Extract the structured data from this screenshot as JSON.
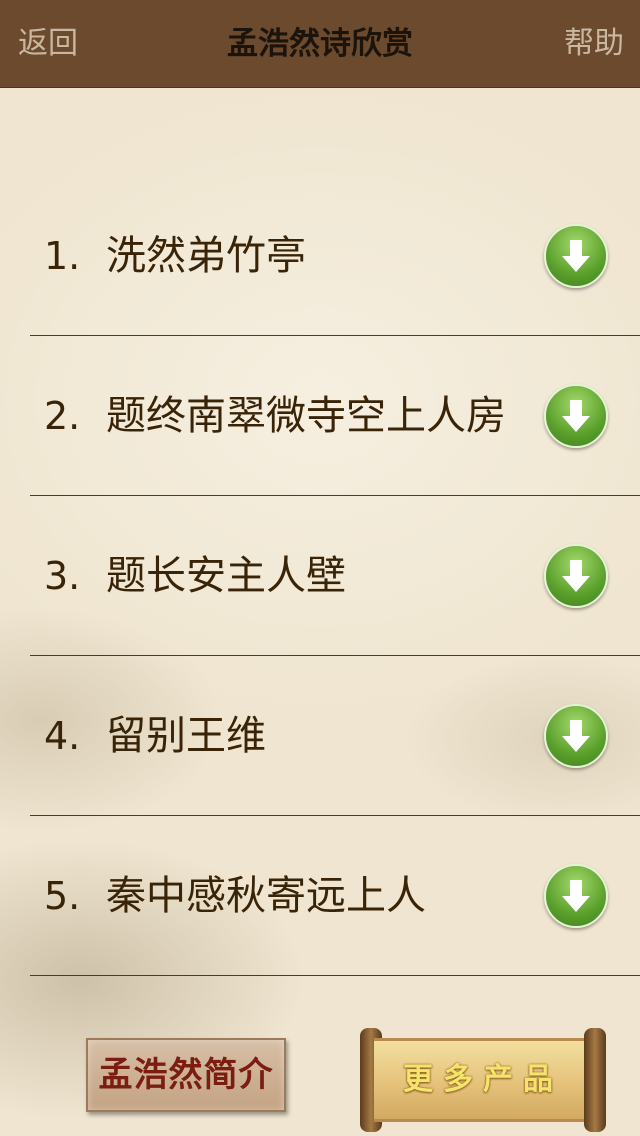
{
  "navbar": {
    "back_label": "返回",
    "title": "孟浩然诗欣赏",
    "help_label": "帮助"
  },
  "poems": [
    {
      "num": "1.",
      "title": "洗然弟竹亭"
    },
    {
      "num": "2.",
      "title": "题终南翠微寺空上人房"
    },
    {
      "num": "3.",
      "title": "题长安主人壁"
    },
    {
      "num": "4.",
      "title": "留别王维"
    },
    {
      "num": "5.",
      "title": "秦中感秋寄远上人"
    }
  ],
  "row_icon": "download-arrow-icon",
  "bottom": {
    "intro_label": "孟浩然简介",
    "more_label": "更多产品"
  },
  "colors": {
    "navbar": "#6b4a2e",
    "nav_button_text": "#c9b79f",
    "title_text": "#1c130b",
    "list_text": "#3a2408",
    "download_green": "#5aa02c"
  }
}
